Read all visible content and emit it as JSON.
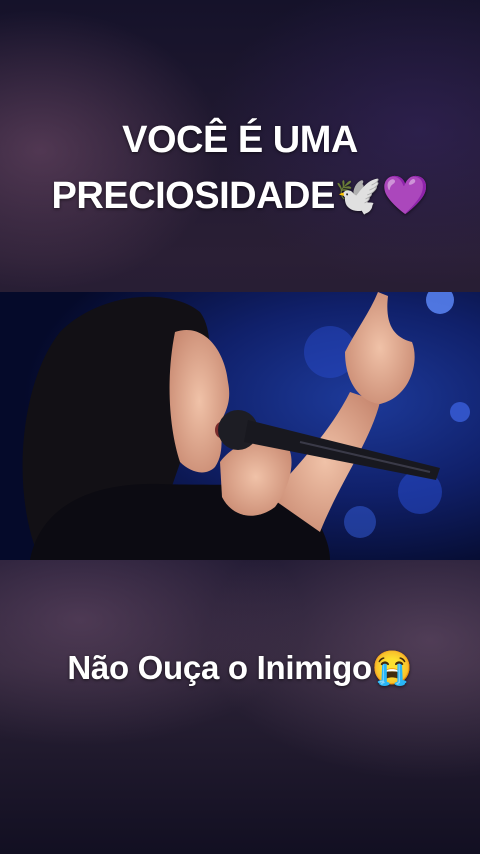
{
  "top_caption": {
    "line1": "VOCÊ É UMA",
    "line2": "PRECIOSIDADE🕊️💜"
  },
  "video": {
    "description_icon": "video-frame"
  },
  "bottom_caption": {
    "text": "Não Ouça o Inimigo😭"
  }
}
